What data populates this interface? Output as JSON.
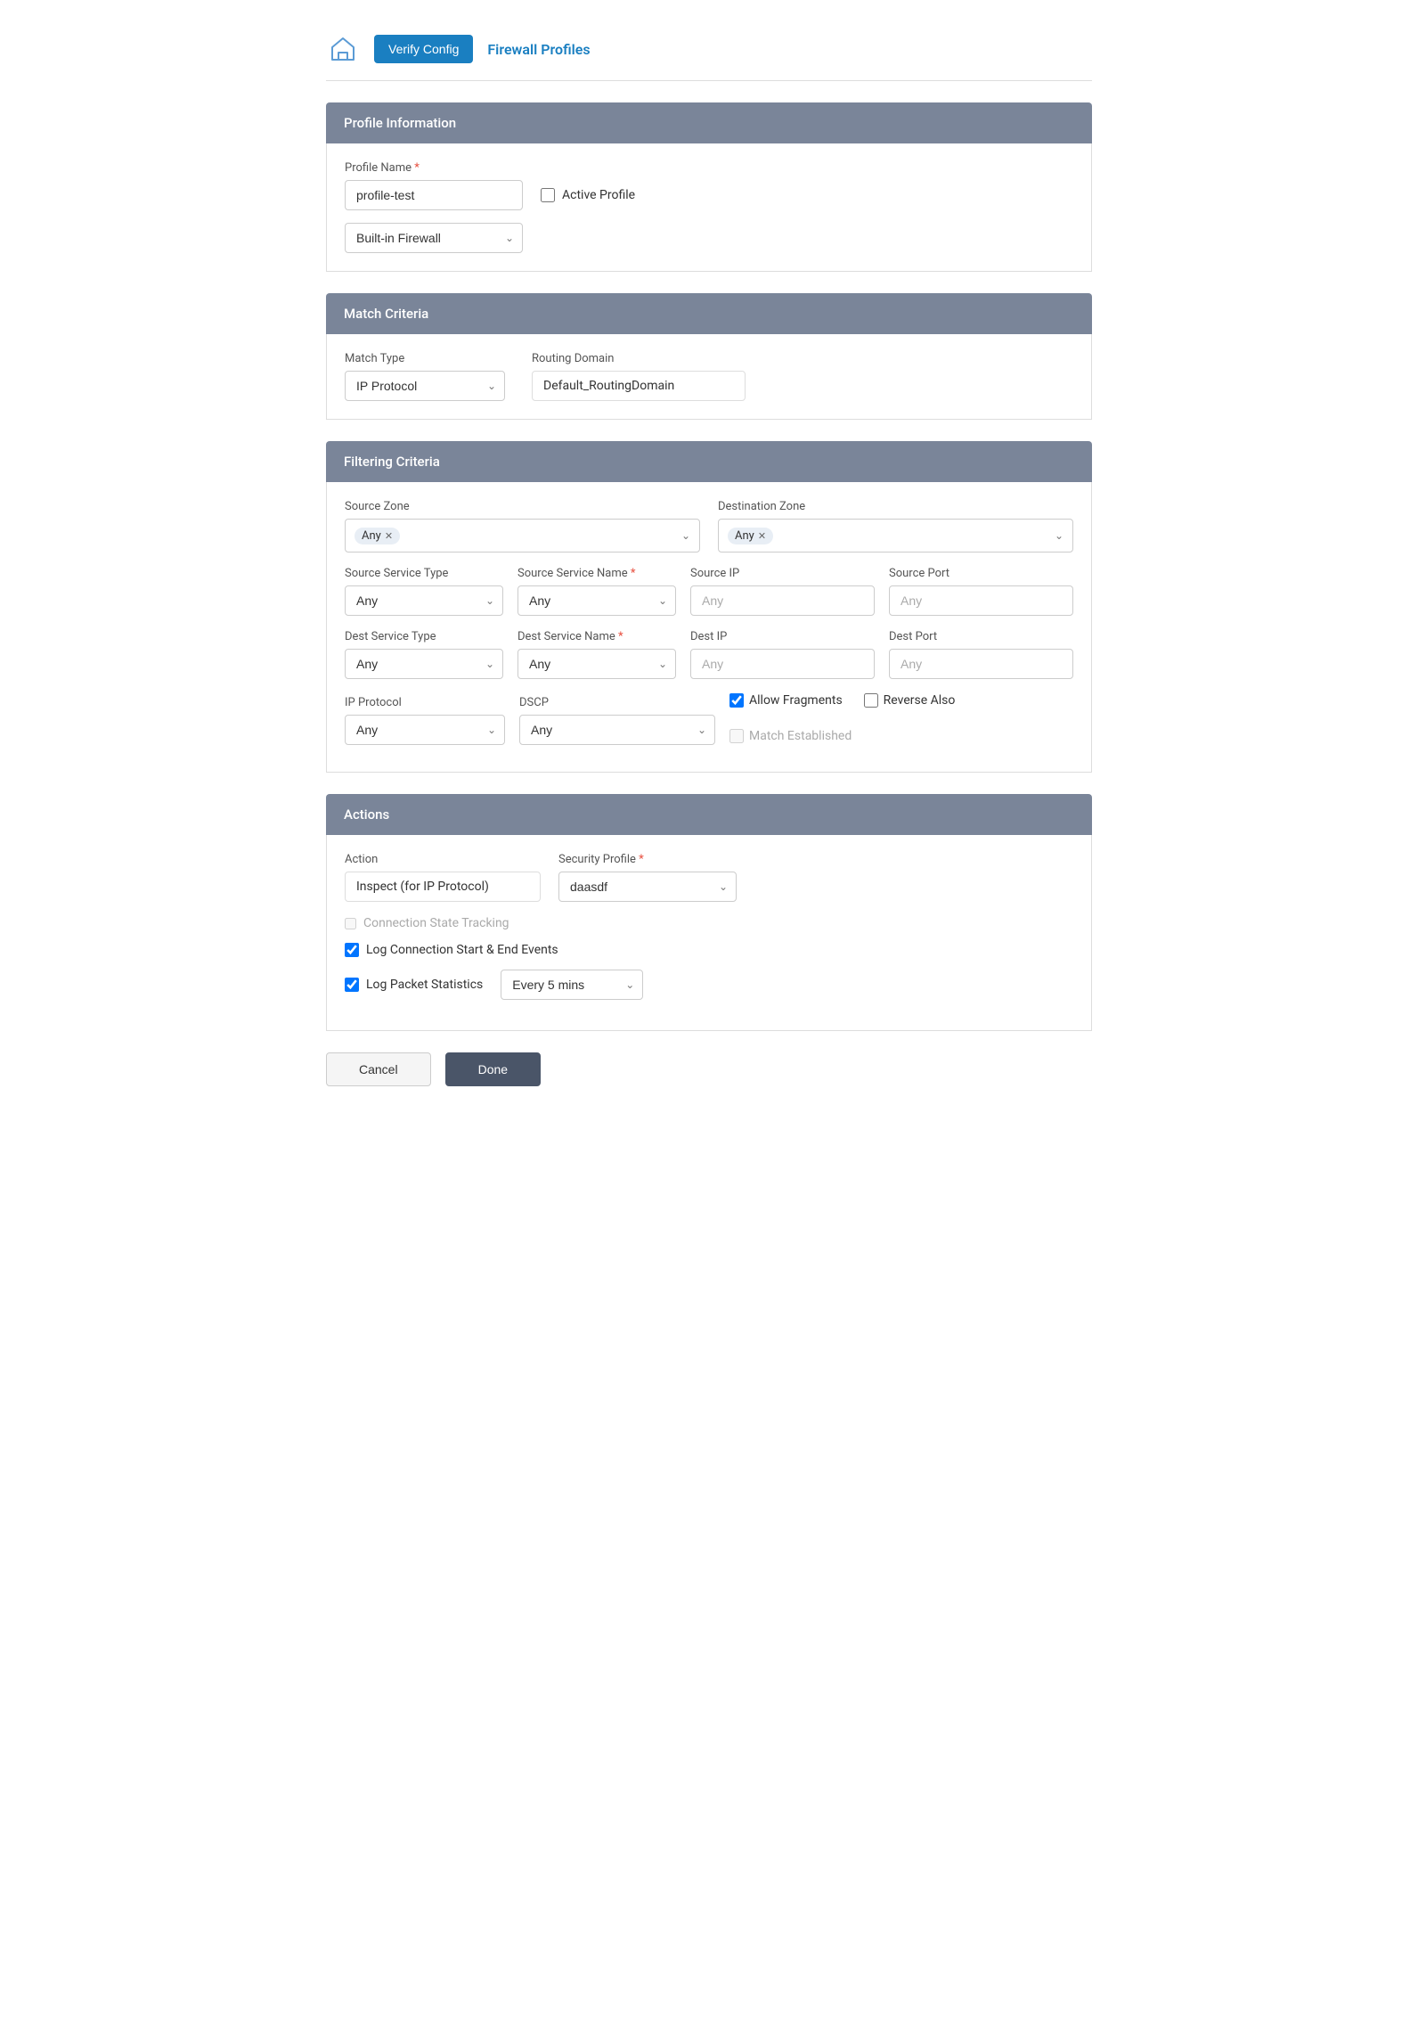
{
  "header": {
    "verify_config_label": "Verify Config",
    "breadcrumb_label": "Firewall Profiles",
    "home_icon": "home"
  },
  "profile_information": {
    "section_title": "Profile Information",
    "profile_name_label": "Profile Name",
    "profile_name_value": "profile-test",
    "active_profile_label": "Active Profile",
    "firewall_type_label": "Built-in Firewall"
  },
  "match_criteria": {
    "section_title": "Match Criteria",
    "match_type_label": "Match Type",
    "match_type_value": "IP Protocol",
    "routing_domain_label": "Routing Domain",
    "routing_domain_value": "Default_RoutingDomain"
  },
  "filtering_criteria": {
    "section_title": "Filtering Criteria",
    "source_zone_label": "Source Zone",
    "source_zone_tag": "Any",
    "dest_zone_label": "Destination Zone",
    "dest_zone_tag": "Any",
    "source_service_type_label": "Source Service Type",
    "source_service_type_value": "Any",
    "source_service_name_label": "Source Service Name",
    "source_service_name_value": "Any",
    "source_ip_label": "Source IP",
    "source_ip_placeholder": "Any",
    "source_port_label": "Source Port",
    "source_port_placeholder": "Any",
    "dest_service_type_label": "Dest Service Type",
    "dest_service_type_value": "Any",
    "dest_service_name_label": "Dest Service Name",
    "dest_service_name_value": "Any",
    "dest_ip_label": "Dest IP",
    "dest_ip_placeholder": "Any",
    "dest_port_label": "Dest Port",
    "dest_port_placeholder": "Any",
    "ip_protocol_label": "IP Protocol",
    "ip_protocol_value": "Any",
    "dscp_label": "DSCP",
    "dscp_value": "Any",
    "allow_fragments_label": "Allow Fragments",
    "allow_fragments_checked": true,
    "reverse_also_label": "Reverse Also",
    "reverse_also_checked": false,
    "match_established_label": "Match Established",
    "match_established_checked": false
  },
  "actions": {
    "section_title": "Actions",
    "action_label": "Action",
    "action_value": "Inspect (for IP Protocol)",
    "security_profile_label": "Security Profile",
    "security_profile_value": "daasdf",
    "connection_state_label": "Connection State Tracking",
    "connection_state_checked": false,
    "log_connection_label": "Log Connection Start & End Events",
    "log_connection_checked": true,
    "log_packet_label": "Log Packet Statistics",
    "log_packet_checked": true,
    "every_mins_label": "Every 5 mins"
  },
  "footer": {
    "cancel_label": "Cancel",
    "done_label": "Done"
  }
}
